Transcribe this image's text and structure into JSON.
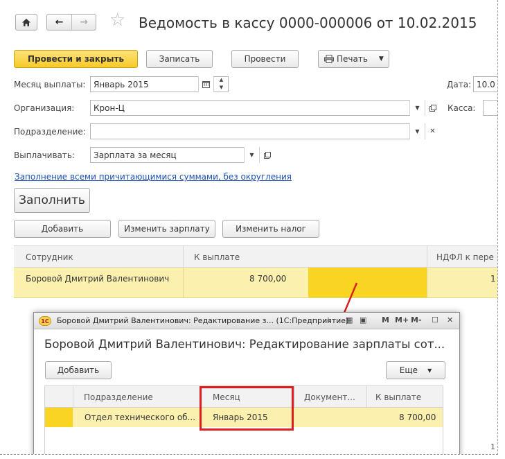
{
  "nav": {
    "home": "home-icon",
    "back": "←",
    "forward": "→",
    "star": "☆"
  },
  "title": "Ведомость в кассу 0000-000006 от 10.02.2015",
  "toolbar": {
    "post_close": "Провести и закрыть",
    "save": "Записать",
    "post": "Провести",
    "print": "Печать"
  },
  "form": {
    "month_label": "Месяц выплаты:",
    "month_value": "Январь 2015",
    "date_label": "Дата:",
    "date_value": "10.0",
    "org_label": "Организация:",
    "org_value": "Крон-Ц",
    "cash_label": "Касса:",
    "dept_label": "Подразделение:",
    "dept_value": "",
    "pay_label": "Выплачивать:",
    "pay_value": "Зарплата за месяц"
  },
  "fill_link": "Заполнение всеми причитающимися суммами, без округления",
  "fill_button": "Заполнить",
  "actions": {
    "add": "Добавить",
    "edit_salary": "Изменить зарплату",
    "edit_tax": "Изменить налог"
  },
  "table": {
    "columns": [
      "Сотрудник",
      "К выплате",
      "НДФЛ к пере"
    ],
    "rows": [
      {
        "employee": "Боровой Дмитрий Валентинович",
        "amount": "8 700,00",
        "ndfl": "1"
      }
    ]
  },
  "popup": {
    "window_title": "Боровой Дмитрий Валентинович: Редактирование з... (1С:Предприятие)",
    "logo": "1С",
    "header": "Боровой Дмитрий Валентинович: Редактирование зарплаты сот...",
    "add": "Добавить",
    "more": "Еще",
    "columns": [
      "Подразделение",
      "Месяц",
      "Документ...",
      "К выплате"
    ],
    "rows": [
      {
        "dept": "Отдел технического об...",
        "month": "Январь 2015",
        "doc": "",
        "amount": "8 700,00"
      }
    ],
    "tb_m": "M",
    "tb_mplus": "M+",
    "tb_mminus": "M-",
    "page_fragment": "1"
  },
  "colors": {
    "accent_yellow": "#f7c928",
    "row_yellow": "#fcf0ae",
    "highlight_red": "#e01b1b",
    "link_blue": "#1a4fb5"
  }
}
